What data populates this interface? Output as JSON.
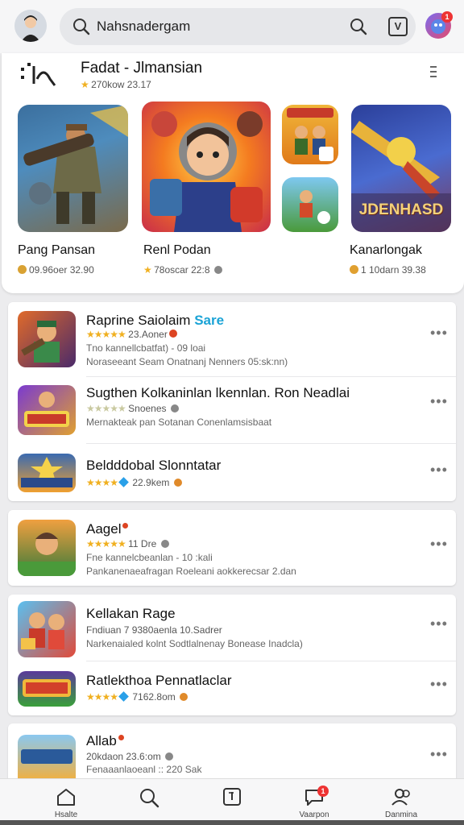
{
  "search": {
    "value": "Nahsnadergam"
  },
  "featured": {
    "title": "Fadat - Jlmansian",
    "subtitle": "270kow 23.17",
    "tiles": [
      {
        "title": "Pang Pansan",
        "meta": "09.96oer 32.90"
      },
      {
        "title": "Renl Podan",
        "meta": "78oscar 22:8"
      },
      {
        "title": "Kanarlongak",
        "meta": "1 10darn 39.38"
      }
    ],
    "mini_banner_text": "JDENHASD"
  },
  "list": [
    {
      "name": "Raprine Saiolaim",
      "tag": "Sare",
      "meta": "23.Aoner",
      "desc1": "Tno kannellcbatfat) - 09 loai",
      "desc2": "Noraseeant Seam Onatnanj Nenners 05:sk:nn)"
    },
    {
      "name": "Sugthen Kolkaninlan lkennlan. Ron Neadlai",
      "meta": "Snoenes",
      "desc1": "Mernakteak pan Sotanan Conenlamsisbaat"
    },
    {
      "name": "Beldddobal Slonntatar",
      "meta": "22.9kem"
    },
    {
      "name": "Aagel",
      "meta": "11 Dre",
      "desc1": "Fne kannelcbeanlan - 10 :kali",
      "desc2": "Pankanenaeafragan Roeleani aokkerecsar 2.dan"
    },
    {
      "name": "Kellakan Rage",
      "meta": "Fndiuan 7 9380aenla 10.Sadrer",
      "desc1": "Narkenaialed kolnt Sodtlalnenay Bonease Inadcla)"
    },
    {
      "name": "Ratlekthoa Pennatlaclar",
      "meta": "7162.8om"
    },
    {
      "name": "Allab",
      "meta": "20kdaon 23.6:om",
      "desc1": "Fenaaanlaoeanl :: 220 Sak"
    }
  ],
  "nav": [
    {
      "label": "Hsalte"
    },
    {
      "label": ""
    },
    {
      "label": ""
    },
    {
      "label": "Vaarpon",
      "badge": "1"
    },
    {
      "label": "Danmina"
    }
  ],
  "badge_top": "1"
}
